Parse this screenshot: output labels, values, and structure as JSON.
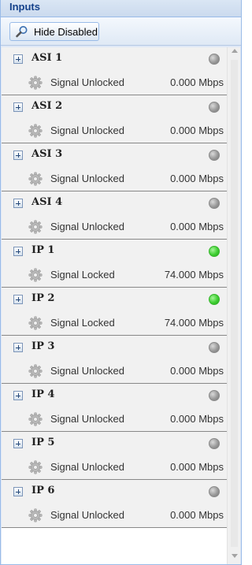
{
  "panel": {
    "title": "Inputs"
  },
  "toolbar": {
    "hide_disabled_label": "Hide Disabled",
    "icon": "search-icon"
  },
  "inputs": [
    {
      "name": "ASI 1",
      "status": "Signal Unlocked",
      "rate": "0.000 Mbps",
      "locked": false
    },
    {
      "name": "ASI 2",
      "status": "Signal Unlocked",
      "rate": "0.000 Mbps",
      "locked": false
    },
    {
      "name": "ASI 3",
      "status": "Signal Unlocked",
      "rate": "0.000 Mbps",
      "locked": false
    },
    {
      "name": "ASI 4",
      "status": "Signal Unlocked",
      "rate": "0.000 Mbps",
      "locked": false
    },
    {
      "name": "IP 1",
      "status": "Signal Locked",
      "rate": "74.000 Mbps",
      "locked": true
    },
    {
      "name": "IP 2",
      "status": "Signal Locked",
      "rate": "74.000 Mbps",
      "locked": true
    },
    {
      "name": "IP 3",
      "status": "Signal Unlocked",
      "rate": "0.000 Mbps",
      "locked": false
    },
    {
      "name": "IP 4",
      "status": "Signal Unlocked",
      "rate": "0.000 Mbps",
      "locked": false
    },
    {
      "name": "IP 5",
      "status": "Signal Unlocked",
      "rate": "0.000 Mbps",
      "locked": false
    },
    {
      "name": "IP 6",
      "status": "Signal Unlocked",
      "rate": "0.000 Mbps",
      "locked": false
    }
  ],
  "colors": {
    "locked": "#3fcf32",
    "unlocked": "#9a9a9a",
    "header_text": "#15428b"
  }
}
